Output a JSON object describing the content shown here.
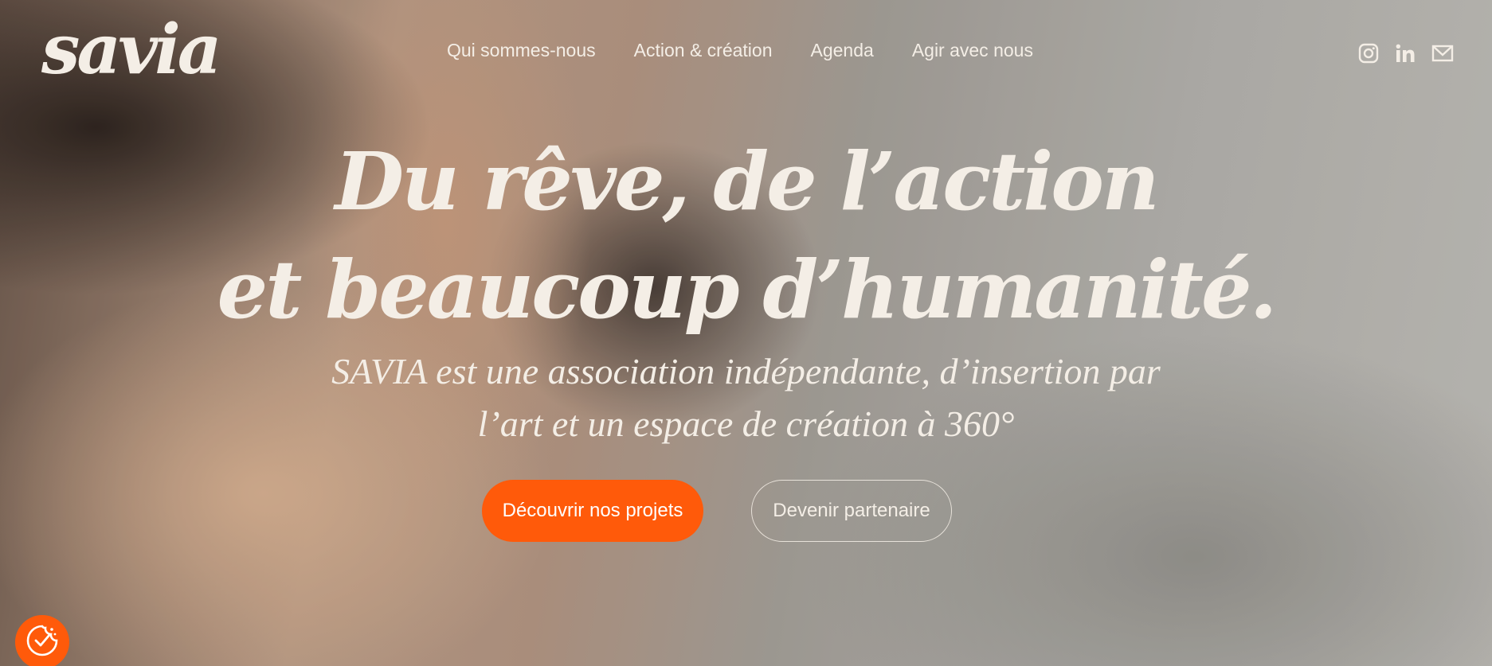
{
  "brand": {
    "logo_text": "savia"
  },
  "nav": {
    "items": [
      {
        "label": "Qui sommes-nous"
      },
      {
        "label": "Action & création"
      },
      {
        "label": "Agenda"
      },
      {
        "label": "Agir avec nous"
      }
    ]
  },
  "socials": {
    "icons": [
      "instagram-icon",
      "linkedin-icon",
      "mail-icon"
    ]
  },
  "hero": {
    "headline_line1": "Du rêve, de l’action",
    "headline_line2": "et beaucoup d’humanité.",
    "subtitle_line1": "SAVIA est une association indépendante, d’insertion par",
    "subtitle_line2": "l’art et un espace de création à 360°",
    "primary_cta": "Découvrir nos projets",
    "secondary_cta": "Devenir partenaire"
  },
  "consent": {
    "icon": "cookie-check-icon"
  },
  "colors": {
    "accent": "#ff5a0a",
    "text_light": "#f4eee6"
  }
}
